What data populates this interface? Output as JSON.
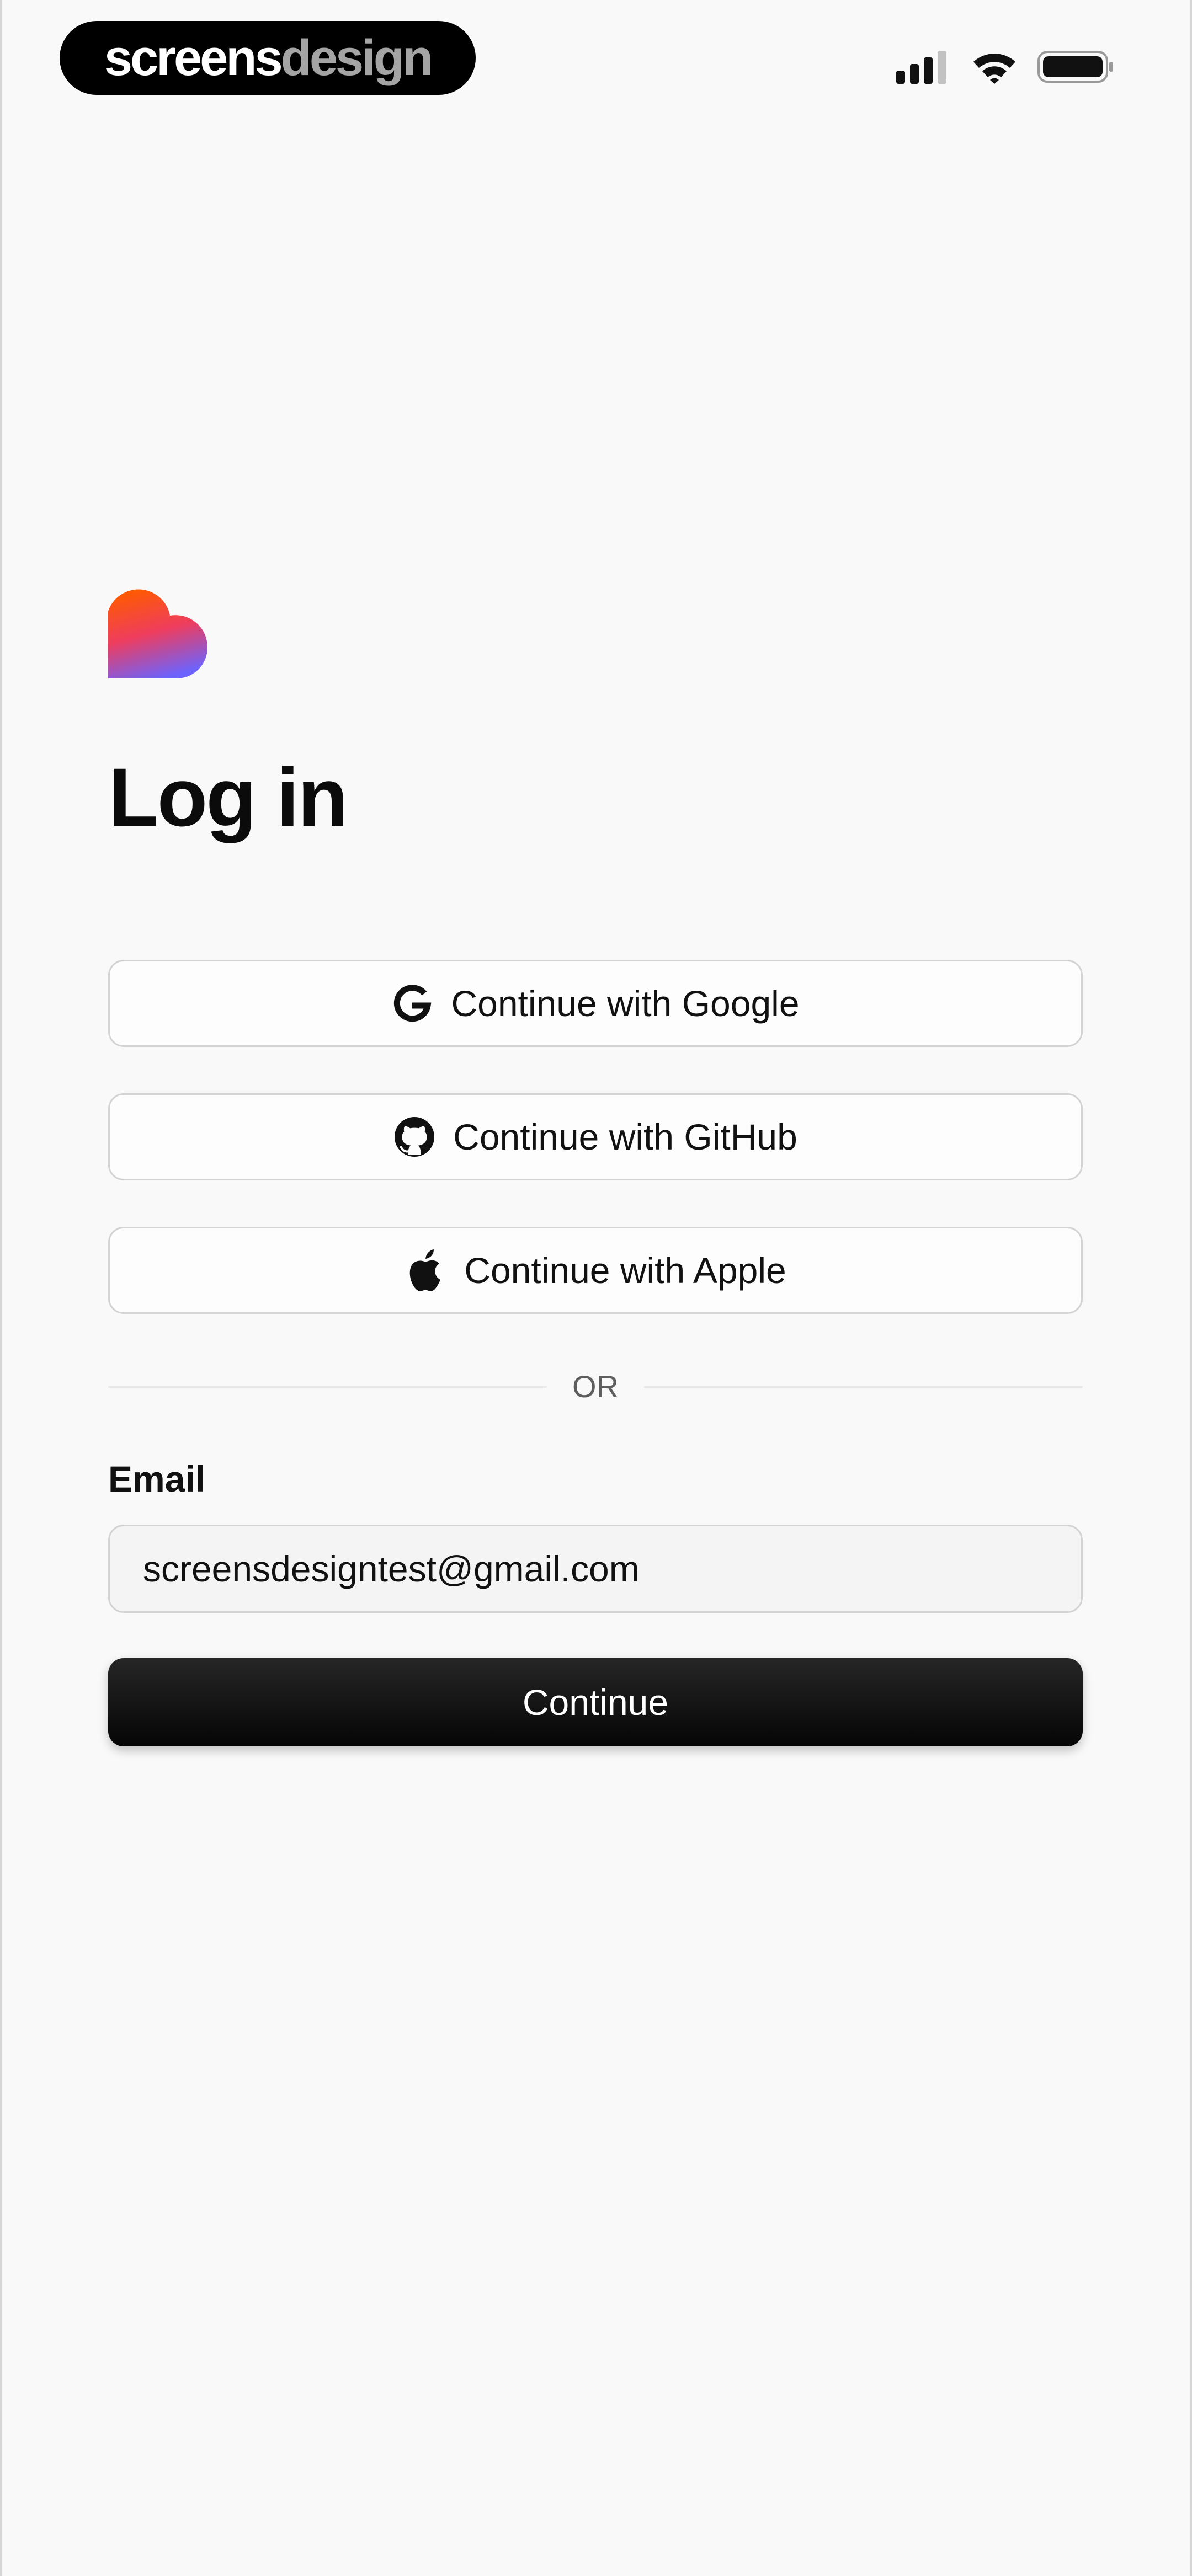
{
  "status_bar": {
    "brand": {
      "part1": "screens",
      "part2": "design"
    },
    "icons": [
      "signal-icon",
      "wifi-icon",
      "battery-icon"
    ]
  },
  "login": {
    "title": "Log in",
    "oauth_buttons": [
      {
        "label": "Continue with Google",
        "icon": "google-icon"
      },
      {
        "label": "Continue with GitHub",
        "icon": "github-icon"
      },
      {
        "label": "Continue with Apple",
        "icon": "apple-icon"
      }
    ],
    "divider_text": "OR",
    "email": {
      "label": "Email",
      "value": "screensdesigntest@gmail.com",
      "placeholder": ""
    },
    "continue_label": "Continue"
  },
  "colors": {
    "background": "#f9f9f9",
    "primary_button": "#0b0b0b",
    "border": "#d3d3d3",
    "logo_gradient": [
      "#ff5a00",
      "#e8338a",
      "#6c63ff"
    ]
  }
}
